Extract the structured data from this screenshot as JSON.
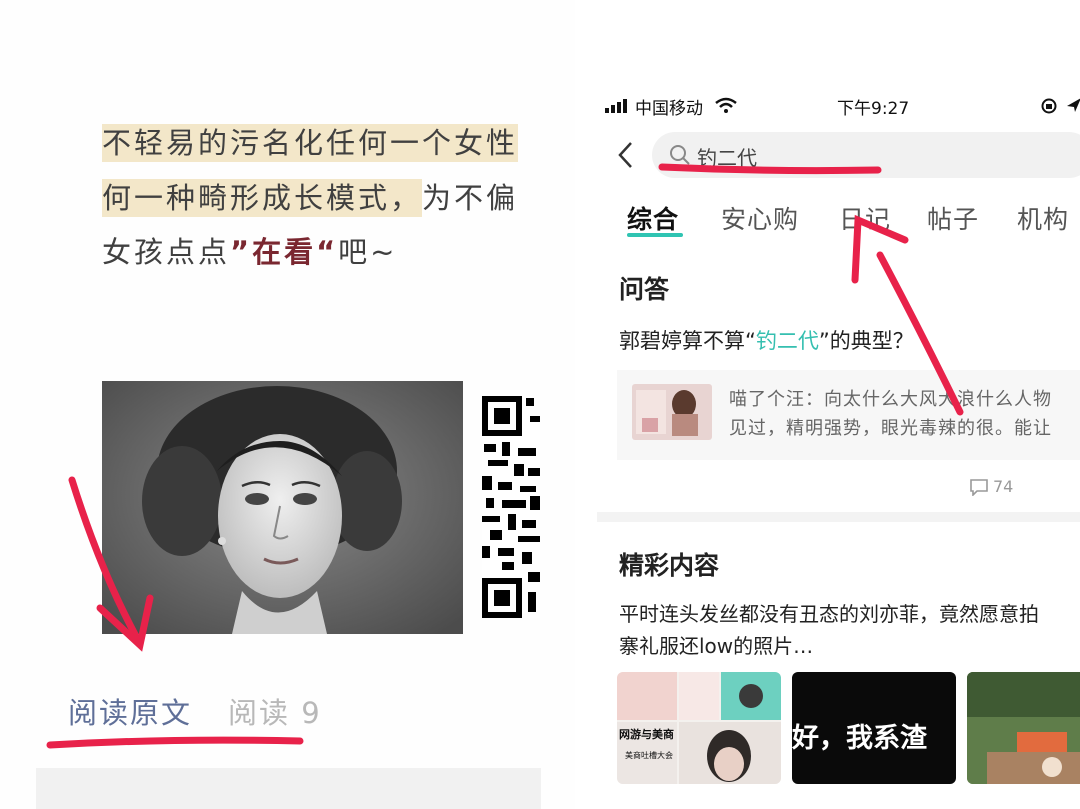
{
  "left": {
    "paragraph_lines": [
      "不轻易的污名化任何一个女性",
      "何一种畸形成长模式，为不偏",
      "女孩点点"
    ],
    "highlight_line1": "不轻易的污名化任何一个女性",
    "highlight_line2": "何一种畸形成长模式，",
    "line2_tail": "为不偏",
    "line3_head": "女孩点点",
    "line3_quote": "”在看“",
    "line3_tail": "吧~",
    "read_original": "阅读原文",
    "read_count": "阅读 9"
  },
  "right": {
    "status": {
      "carrier": "中国移动",
      "time": "下午9:27"
    },
    "search": {
      "query": "钓二代"
    },
    "tabs": [
      {
        "label": "综合",
        "active": true
      },
      {
        "label": "安心购",
        "active": false
      },
      {
        "label": "日记",
        "active": false
      },
      {
        "label": "帖子",
        "active": false
      },
      {
        "label": "机构",
        "active": false
      }
    ],
    "qa": {
      "title": "问答",
      "question_head": "郭碧婷算不算“",
      "question_keyword": "钓二代",
      "question_tail": "”的典型？",
      "answer_line1": "喵了个汪：向太什么大风大浪什么人物",
      "answer_line2": "见过，精明强势，眼光毒辣的很。能让",
      "comment_count": "74"
    },
    "featured": {
      "title": "精彩内容",
      "line1": "平时连头发丝都没有丑态的刘亦菲，竟然愿意拍",
      "line2": "寨礼服还low的照片…",
      "thumb1_caption": "网游与美商",
      "thumb1_sub": "美商吐槽大会",
      "thumb2_caption": "好，我系渣"
    }
  },
  "colors": {
    "accent": "#35bfb0",
    "annotation_red": "#e8224a",
    "highlight": "#f3e7c9",
    "link": "#5f6f98"
  }
}
